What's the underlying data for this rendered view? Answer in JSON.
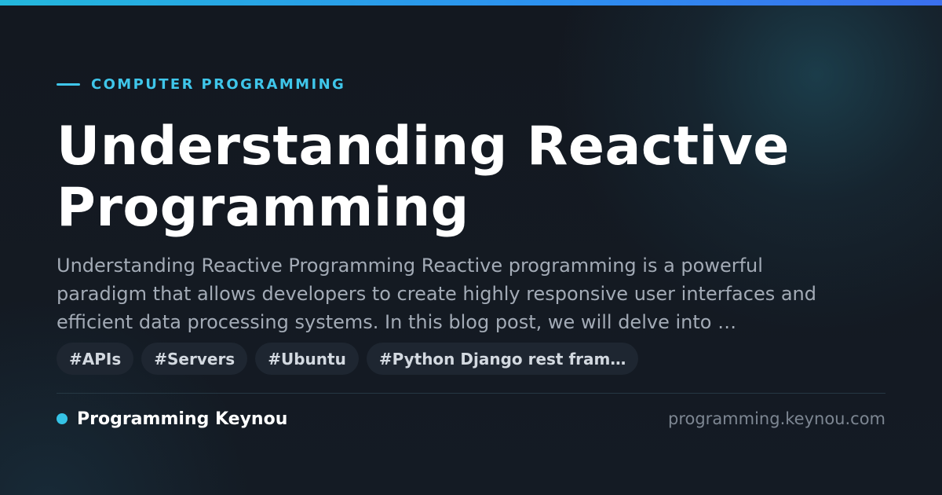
{
  "category": "COMPUTER PROGRAMMING",
  "title": "Understanding Reactive Programming",
  "excerpt": "Understanding Reactive Programming Reactive programming is a powerful paradigm that allows developers to create highly responsive user interfaces and efficient data processing systems. In this blog post, we will delve into …",
  "tags": [
    "#APIs",
    "#Servers",
    "#Ubuntu",
    "#Python Django rest fram…"
  ],
  "brand": {
    "name": "Programming Keynou"
  },
  "site_domain": "programming.keynou.com",
  "colors": {
    "accent": "#3fc6ea",
    "background": "#141922",
    "title": "#ffffff",
    "excerpt": "#a3abb6",
    "tag_bg": "#1e2631"
  }
}
